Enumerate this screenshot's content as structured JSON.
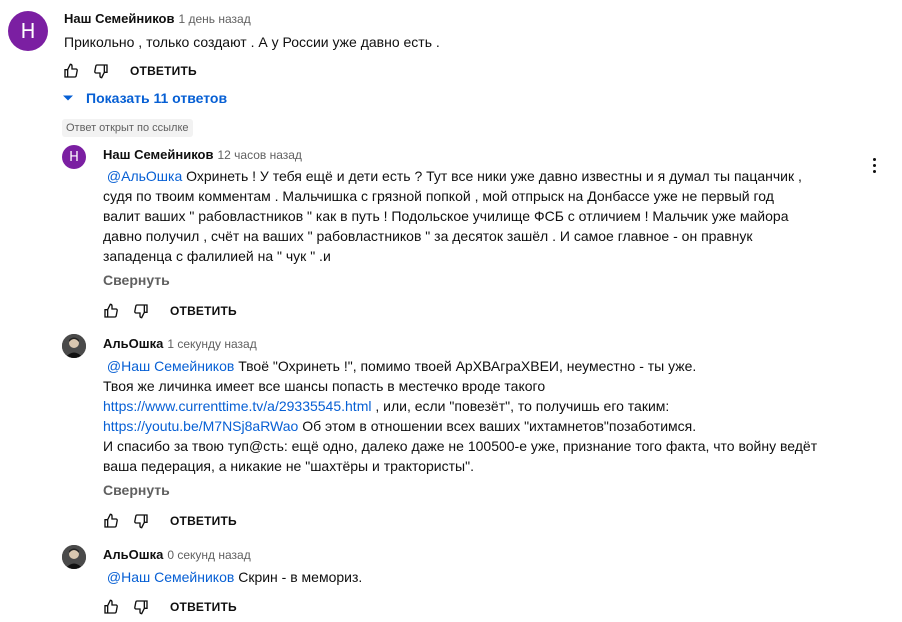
{
  "top_comment": {
    "avatar_letter": "Н",
    "author": "Наш Семейников",
    "time": "1 день назад",
    "text": "Прикольно , только создают . А у России уже давно есть .",
    "reply_label": "ОТВЕТИТЬ"
  },
  "show_replies_label": "Показать 11 ответов",
  "highlight_badge": "Ответ открыт по ссылке",
  "reply1": {
    "avatar_letter": "Н",
    "author": "Наш Семейников",
    "time": "12 часов назад",
    "mention": "@АльОшка",
    "text_line1": " Охринеть ! У тебя ещё и дети есть ? Тут все ники уже давно известны и я думал ты пацанчик ,",
    "text_line2": "судя по твоим комментам . Мальчишка с грязной  попкой , мой отпрыск на Донбассе уже не первый год",
    "text_line3": "валит ваших \" рабовластников \" как в путь ! Подольское училище ФСБ с отличием ! Мальчик уже майора",
    "text_line4": "давно получил , счёт на ваших \" рабовластников \" за десяток зашёл .  И самое главное - он правнук",
    "text_line5": "западенца с фалилией на \" чук \" .и",
    "collapse_label": "Свернуть",
    "reply_label": "ОТВЕТИТЬ"
  },
  "reply2": {
    "author": "АльОшка",
    "time": "1 секунду назад",
    "mention": "@Наш Семейников",
    "line1_rest": " Твоё \"Охринеть !\", помимо твоей АрХВАграХВЕИ, неуместно - ты уже.",
    "line2": "Твоя же личинка имеет все шансы попасть в местечко вроде такого",
    "link1": "https://www.currenttime.tv/a/29335545.html",
    "line3_rest": " , или, если \"повезёт\", то получишь его таким:",
    "link2": "https://youtu.be/M7NSj8aRWao",
    "line4_rest": " Об этом в отношении всех ваших \"ихтамнетов\"позаботимся.",
    "line5": "И спасибо за твою туп@сть: ещё одно, далеко даже не 100500-е уже, признание того факта, что войну ведёт",
    "line6": "ваша педерация, а никакие не \"шахтёры и трактористы\".",
    "collapse_label": "Свернуть",
    "reply_label": "ОТВЕТИТЬ"
  },
  "reply3": {
    "author": "АльОшка",
    "time": "0 секунд назад",
    "mention": "@Наш Семейников",
    "text_rest": " Скрин - в мемориз.",
    "reply_label": "ОТВЕТИТЬ"
  },
  "colors": {
    "avatar": "#7b1fa2",
    "link": "#065fd4",
    "secondary": "#606060"
  }
}
